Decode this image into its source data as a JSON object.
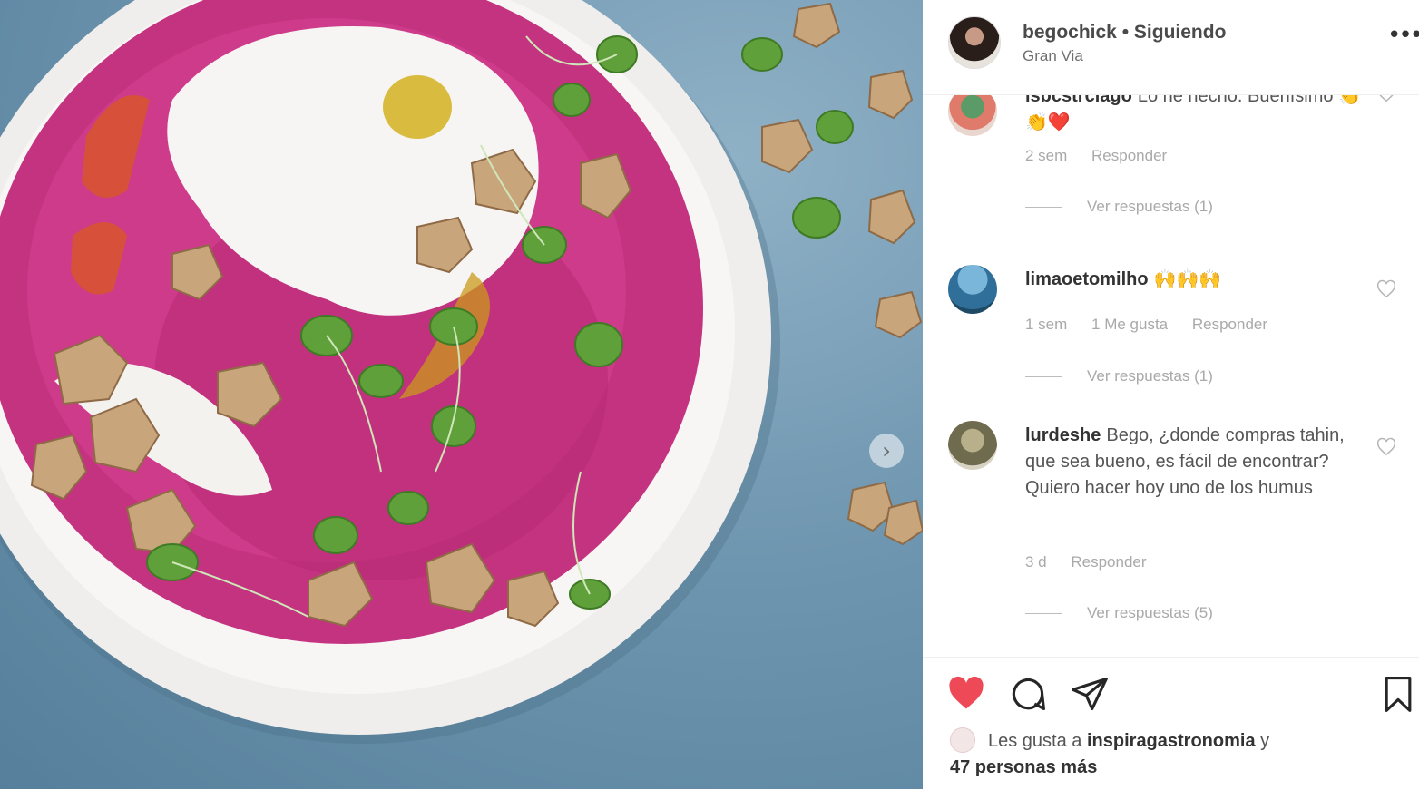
{
  "post": {
    "username": "begochick",
    "follow_state": "Siguiendo",
    "separator": "•",
    "location": "Gran Via"
  },
  "comments": [
    {
      "username": "isbcstrclago",
      "text": "Lo he hecho. Buenísimo 👏👏❤️",
      "time": "2 sem",
      "likes": "",
      "reply": "Responder",
      "replies_label": "Ver respuestas (1)"
    },
    {
      "username": "limaoetomilho",
      "text": "🙌🙌🙌",
      "time": "1 sem",
      "likes": "1 Me gusta",
      "reply": "Responder",
      "replies_label": "Ver respuestas (1)"
    },
    {
      "username": "lurdeshe",
      "text": "Bego, ¿donde compras tahin, que sea bueno, es fácil de encontrar? Quiero hacer hoy uno de los humus",
      "time": "3 d",
      "likes": "",
      "reply": "Responder",
      "replies_label": "Ver respuestas (5)"
    }
  ],
  "likes_summary": {
    "prefix": "Les gusta a",
    "user": "inspiragastronomia",
    "conj": "y",
    "others": "47 personas más"
  },
  "icons": {
    "like": "heart-filled-icon",
    "comment": "comment-bubble-icon",
    "share": "paper-plane-icon",
    "save": "bookmark-icon",
    "next": "chevron-right-icon",
    "more": "more-options-icon"
  },
  "colors": {
    "like_red": "#ed4956",
    "hummus_pink": "#c2307a",
    "background_blue": "#6f96b0"
  }
}
